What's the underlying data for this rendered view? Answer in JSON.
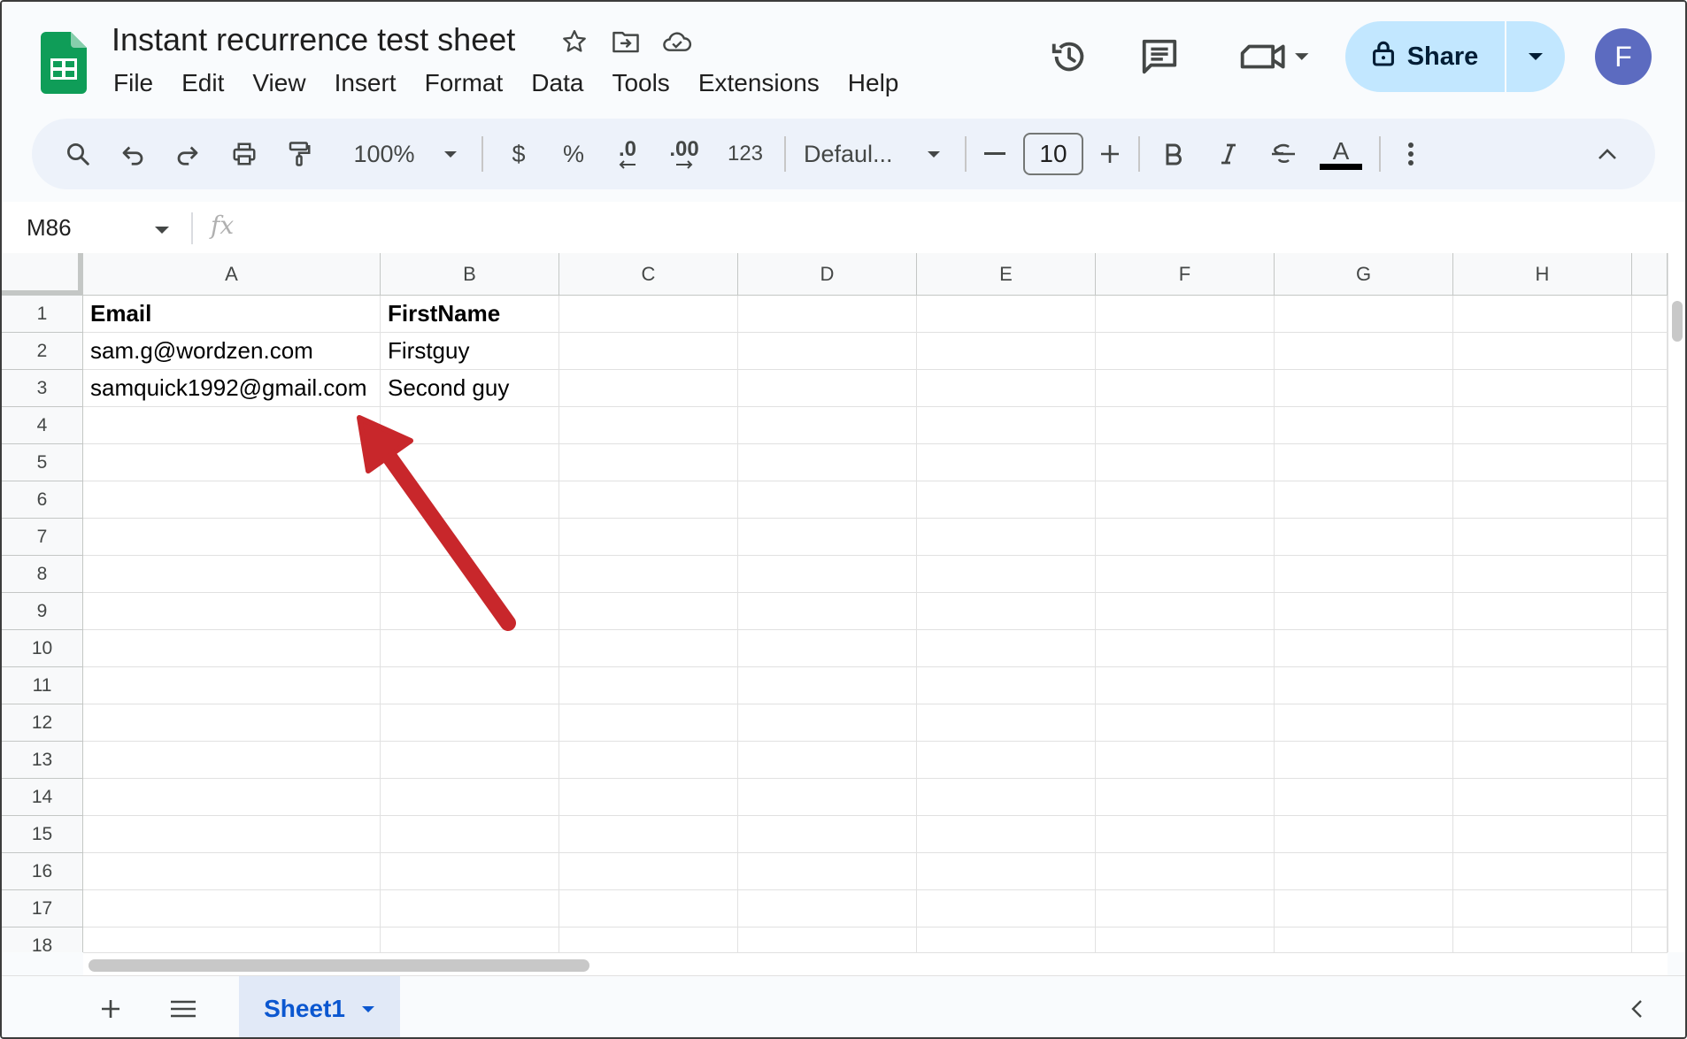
{
  "app": {
    "title": "Instant recurrence test sheet",
    "menu": [
      "File",
      "Edit",
      "View",
      "Insert",
      "Format",
      "Data",
      "Tools",
      "Extensions",
      "Help"
    ],
    "share_label": "Share",
    "avatar_letter": "F"
  },
  "toolbar": {
    "zoom": "100%",
    "currency": "$",
    "percent": "%",
    "dec_decrease": ".0",
    "dec_increase": ".00",
    "number_format": "123",
    "font": "Defaul...",
    "font_size": "10",
    "text_color_letter": "A"
  },
  "formula_bar": {
    "name_box": "M86",
    "fx": "fx",
    "value": ""
  },
  "grid": {
    "columns": [
      "A",
      "B",
      "C",
      "D",
      "E",
      "F",
      "G",
      "H"
    ],
    "rows": [
      "1",
      "2",
      "3",
      "4",
      "5",
      "6",
      "7",
      "8",
      "9",
      "10",
      "11",
      "12",
      "13",
      "14",
      "15",
      "16",
      "17",
      "18"
    ],
    "cells": [
      [
        "Email",
        "FirstName"
      ],
      [
        "sam.g@wordzen.com",
        "Firstguy"
      ],
      [
        "samquick1992@gmail.com",
        "Second guy"
      ]
    ]
  },
  "sheets": {
    "tabs": [
      "Sheet1"
    ],
    "active": "Sheet1"
  },
  "colors": {
    "share_bg": "#c2e7ff",
    "toolbar_bg": "#edf2fa",
    "sheets_green": "#0f9d58",
    "arrow_red": "#c8272b",
    "avatar": "#5c6bc0",
    "active_tab_text": "#0b57d0"
  },
  "icons": {
    "title": [
      "star-icon",
      "move-to-folder-icon",
      "cloud-saved-icon"
    ],
    "top_right": [
      "version-history-icon",
      "comments-icon",
      "meet-video-icon",
      "lock-icon"
    ],
    "toolbar": [
      "search-icon",
      "undo-icon",
      "redo-icon",
      "print-icon",
      "paint-format-icon",
      "bold-icon",
      "italic-icon",
      "strikethrough-icon",
      "text-color-icon",
      "more-icon",
      "collapse-icon"
    ],
    "sheetbar": [
      "add-sheet-icon",
      "all-sheets-icon",
      "explore-collapse-icon"
    ]
  }
}
